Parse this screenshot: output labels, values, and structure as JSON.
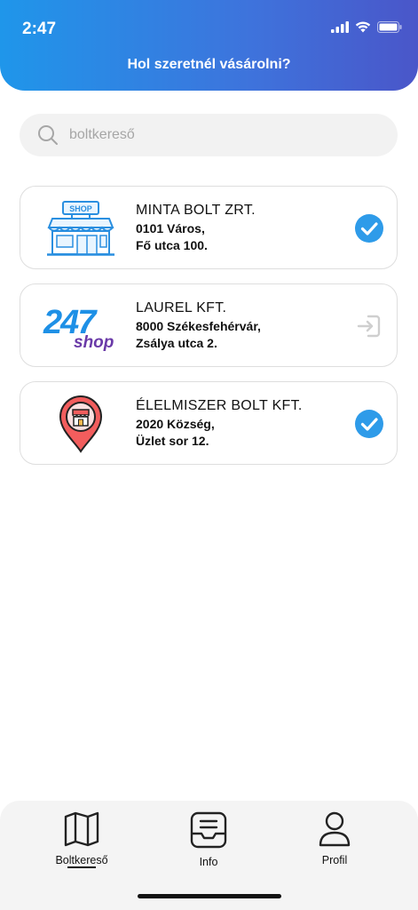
{
  "status_bar": {
    "time": "2:47"
  },
  "header": {
    "title": "Hol szeretnél vásárolni?"
  },
  "search": {
    "placeholder": "boltkereső",
    "value": ""
  },
  "stores": [
    {
      "name": "MINTA BOLT ZRT.",
      "line1": "0101 Város,",
      "line2": "Fő utca 100.",
      "logo": "shop-storefront-icon",
      "action": "check-icon"
    },
    {
      "name": "LAUREL KFT.",
      "line1": "8000 Székesfehérvár,",
      "line2": "Zsálya utca 2.",
      "logo": "247-shop-logo",
      "logo_text": {
        "number": "247",
        "sub": "shop"
      },
      "action": "login-icon"
    },
    {
      "name": "ÉLELMISZER BOLT KFT.",
      "line1": "2020 Község,",
      "line2": "Üzlet sor 12.",
      "logo": "map-pin-store-icon",
      "action": "check-icon"
    }
  ],
  "nav": [
    {
      "label": "Boltkereső",
      "icon": "map-icon",
      "active": true
    },
    {
      "label": "Info",
      "icon": "inbox-icon",
      "active": false
    },
    {
      "label": "Profil",
      "icon": "user-icon",
      "active": false
    }
  ],
  "colors": {
    "header_start": "#1f96ea",
    "header_end": "#4a56c9",
    "check": "#2e9be9",
    "logo_247_blue": "#1e90e6",
    "logo_247_purple": "#6a3aa8"
  }
}
